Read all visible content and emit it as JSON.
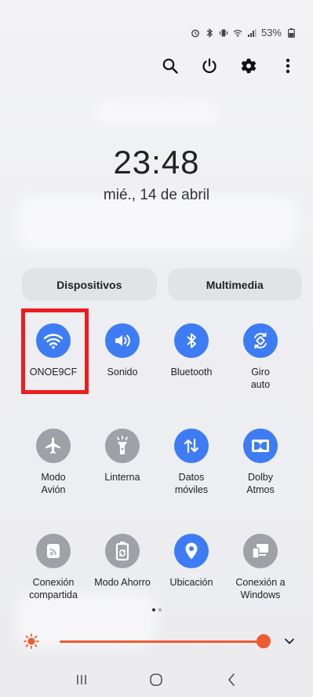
{
  "status_bar": {
    "battery_text": "53%",
    "icons": [
      "alarm-icon",
      "bluetooth-icon",
      "vibrate-icon",
      "wifi-signal-icon",
      "cell-signal-icon",
      "battery-icon"
    ]
  },
  "toolbar": {
    "icons": [
      "search-icon",
      "power-icon",
      "settings-icon",
      "more-options-icon"
    ]
  },
  "clock": {
    "time": "23:48",
    "date": "mié., 14 de abril"
  },
  "tabs": [
    {
      "label": "Dispositivos"
    },
    {
      "label": "Multimedia"
    }
  ],
  "tiles": [
    {
      "label": "ONOE9CF",
      "icon": "wifi-icon",
      "active": true
    },
    {
      "label": "Sonido",
      "icon": "speaker-icon",
      "active": true
    },
    {
      "label": "Bluetooth",
      "icon": "bluetooth-icon",
      "active": true
    },
    {
      "label": "Giro\nauto",
      "icon": "auto-rotate-icon",
      "active": true
    },
    {
      "label": "Modo\nAvión",
      "icon": "airplane-icon",
      "active": false
    },
    {
      "label": "Linterna",
      "icon": "flashlight-icon",
      "active": false
    },
    {
      "label": "Datos\nmóviles",
      "icon": "mobile-data-icon",
      "active": true
    },
    {
      "label": "Dolby\nAtmos",
      "icon": "dolby-icon",
      "active": true
    },
    {
      "label": "Conexión\ncompartida",
      "icon": "hotspot-icon",
      "active": false
    },
    {
      "label": "Modo Ahorro",
      "icon": "battery-saver-icon",
      "active": false
    },
    {
      "label": "Ubicación",
      "icon": "location-icon",
      "active": true
    },
    {
      "label": "Conexión a\nWindows",
      "icon": "link-to-windows-icon",
      "active": false
    }
  ],
  "page_indicator": {
    "current": 1,
    "total": 2
  },
  "brightness": {
    "level": 0.98
  },
  "colors": {
    "accent": "#3d7cf4",
    "inactive": "#9fa1a6",
    "brightness": "#f05a32",
    "highlight": "#ee1c1c"
  },
  "navbar": {
    "icons": [
      "recents-icon",
      "home-icon",
      "back-icon"
    ]
  }
}
